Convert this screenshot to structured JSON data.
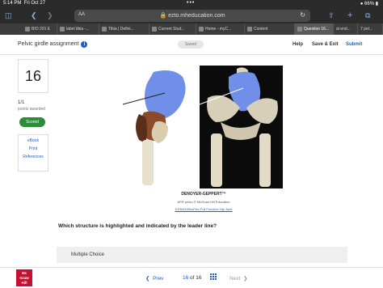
{
  "status": {
    "time": "5:14 PM",
    "date": "Fri Oct 27",
    "dots": "•••",
    "battery": "66%"
  },
  "browser": {
    "aa": "AA",
    "url": "ezto.mheducation.com",
    "tabs": [
      {
        "label": "BIO 201 E"
      },
      {
        "label": "label tibia -..."
      },
      {
        "label": "Tibia | Defini..."
      },
      {
        "label": "Current Stud..."
      },
      {
        "label": "Home - myC..."
      },
      {
        "label": "Content"
      },
      {
        "label": "Question 16..."
      },
      {
        "label": "al end..."
      },
      {
        "label": "7 pel..."
      }
    ]
  },
  "header": {
    "title": "Pelvic girdle assignment",
    "saved": "Saved",
    "help": "Help",
    "save_exit": "Save & Exit",
    "submit": "Submit"
  },
  "question": {
    "number": "16",
    "points": "1/1",
    "points_label": "points awarded",
    "status": "Scored",
    "links": [
      "eBook",
      "Print",
      "References"
    ],
    "brand": "DENOYER-GEPPERT™",
    "credit": "APR photo © McGraw-Hill Education",
    "ext_link": "SJR#41t/BroFlex Full Function Hip Joint",
    "text": "Which structure is highlighted and indicated by the leader line?",
    "answer_type": "Multiple Choice"
  },
  "pager": {
    "logo_lines": [
      "Mc",
      "Graw",
      "Hill"
    ],
    "prev": "Prev",
    "current": "16",
    "of": "of",
    "total": "16",
    "next": "Next"
  }
}
